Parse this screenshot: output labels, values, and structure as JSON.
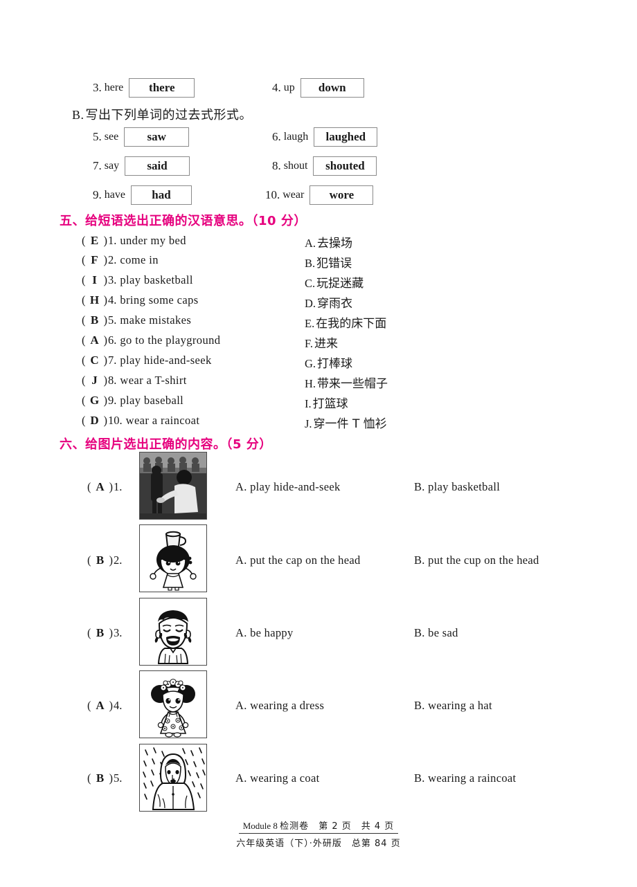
{
  "partA": {
    "rows": [
      {
        "num": "3.",
        "prompt": "here",
        "answer": "there"
      },
      {
        "num": "4.",
        "prompt": "up",
        "answer": "down"
      }
    ]
  },
  "partB": {
    "label": "B.",
    "title": "写出下列单词的过去式形式。",
    "rows": [
      {
        "num": "5.",
        "prompt": "see",
        "answer": "saw"
      },
      {
        "num": "6.",
        "prompt": "laugh",
        "answer": "laughed"
      },
      {
        "num": "7.",
        "prompt": "say",
        "answer": "said"
      },
      {
        "num": "8.",
        "prompt": "shout",
        "answer": "shouted"
      },
      {
        "num": "9.",
        "prompt": "have",
        "answer": "had"
      },
      {
        "num": "10.",
        "prompt": "wear",
        "answer": "wore"
      }
    ]
  },
  "section5": {
    "heading": "五、给短语选出正确的汉语意思。（10 分）",
    "heading_color": "#e6007e",
    "items": [
      {
        "answer": "E",
        "no": "1.",
        "text": "under my bed"
      },
      {
        "answer": "F",
        "no": "2.",
        "text": "come in"
      },
      {
        "answer": "I",
        "no": "3.",
        "text": "play basketball"
      },
      {
        "answer": "H",
        "no": "4.",
        "text": "bring some caps"
      },
      {
        "answer": "B",
        "no": "5.",
        "text": "make mistakes"
      },
      {
        "answer": "A",
        "no": "6.",
        "text": "go to the playground"
      },
      {
        "answer": "C",
        "no": "7.",
        "text": "play hide-and-seek"
      },
      {
        "answer": "J",
        "no": "8.",
        "text": "wear a T-shirt"
      },
      {
        "answer": "G",
        "no": "9.",
        "text": "play baseball"
      },
      {
        "answer": "D",
        "no": "10.",
        "text": "wear a raincoat"
      }
    ],
    "options": [
      {
        "letter": "A.",
        "text": "去操场"
      },
      {
        "letter": "B.",
        "text": "犯错误"
      },
      {
        "letter": "C.",
        "text": "玩捉迷藏"
      },
      {
        "letter": "D.",
        "text": "穿雨衣"
      },
      {
        "letter": "E.",
        "text": "在我的床下面"
      },
      {
        "letter": "F.",
        "text": "进来"
      },
      {
        "letter": "G.",
        "text": "打棒球"
      },
      {
        "letter": "H.",
        "text": "带来一些帽子"
      },
      {
        "letter": "I.",
        "text": "打篮球"
      },
      {
        "letter": "J.",
        "text": "穿一件 T 恤衫"
      }
    ]
  },
  "section6": {
    "heading": "六、给图片选出正确的内容。（5 分）",
    "heading_color": "#e6007e",
    "questions": [
      {
        "answer": "A",
        "no": "1.",
        "picture": "photo-children-playing",
        "optionA": "A. play hide-and-seek",
        "optionB": "B. play basketball"
      },
      {
        "answer": "B",
        "no": "2.",
        "picture": "girl-with-cup-on-head",
        "optionA": "A. put the cap on the head",
        "optionB": "B. put the cup on the head"
      },
      {
        "answer": "B",
        "no": "3.",
        "picture": "crying-sad-boy",
        "optionA": "A. be happy",
        "optionB": "B. be sad"
      },
      {
        "answer": "A",
        "no": "4.",
        "picture": "girl-wearing-dress",
        "optionA": "A.  wearing a dress",
        "optionB": "B. wearing a hat"
      },
      {
        "answer": "B",
        "no": "5.",
        "picture": "person-in-raincoat-in-rain",
        "optionA": "A. wearing a coat",
        "optionB": "B. wearing a raincoat"
      }
    ]
  },
  "footer": {
    "line1_a": "Module 8 ",
    "line1_b": "检测卷",
    "line1_c": "　第 2 页　共 4 页",
    "line2": "六年级英语（下）·外研版　总第 84 页"
  }
}
